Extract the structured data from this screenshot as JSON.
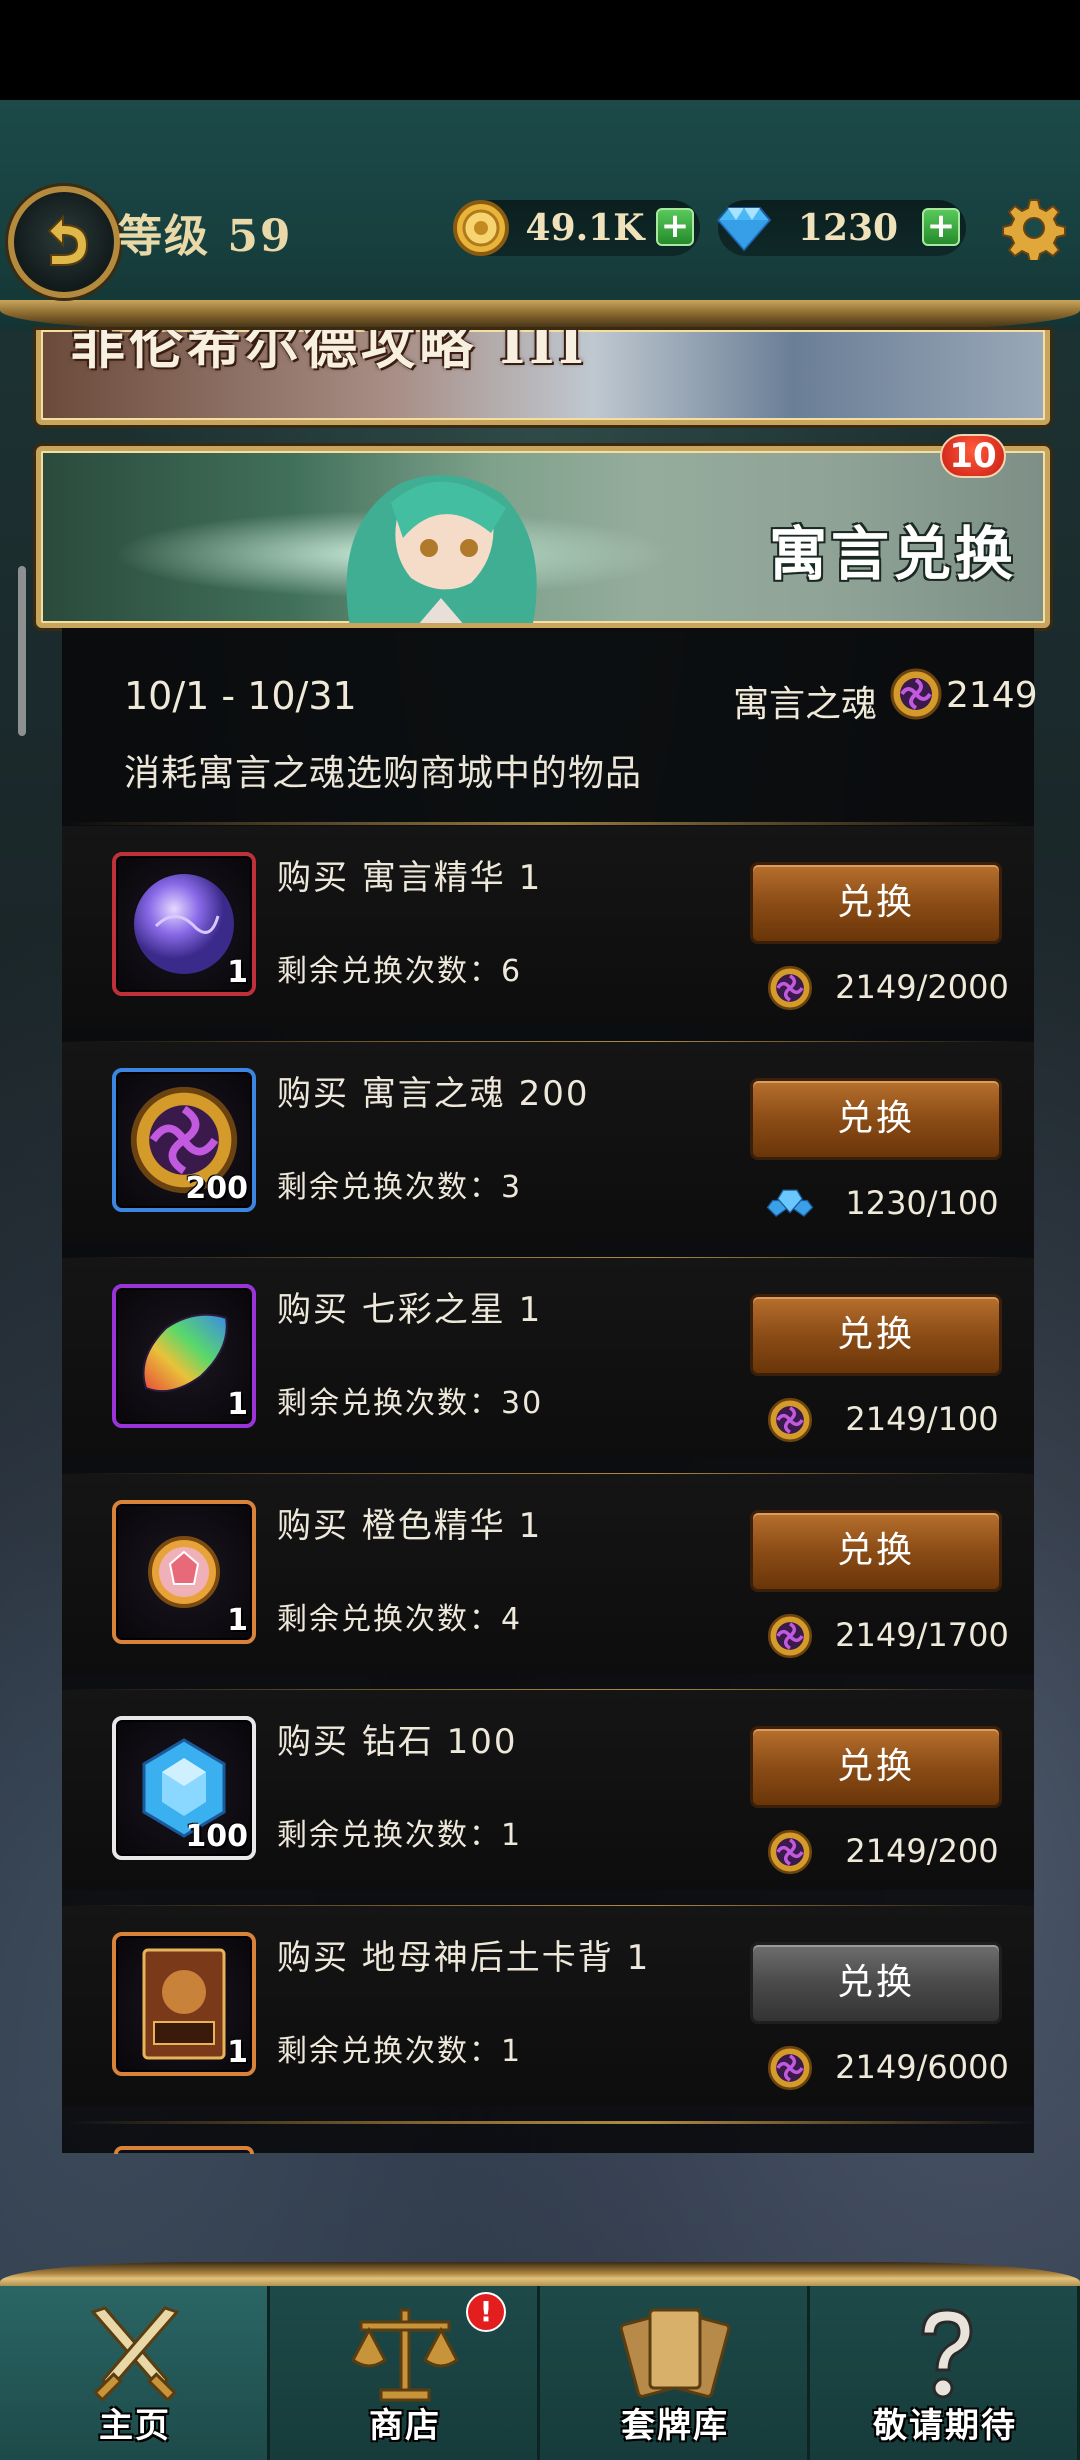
{
  "header": {
    "level_label": "等级 59",
    "coins": "49.1K",
    "gems": "1230",
    "plus_label": "+"
  },
  "banners": {
    "top_partial_title": "菲伦希尔德攻略 III",
    "exchange_title": "寓言兑换",
    "badge_count": "10"
  },
  "event": {
    "date_range": "10/1 - 10/31",
    "currency_label": "寓言之魂",
    "currency_amount": "2149",
    "description": "消耗寓言之魂选购商城中的物品"
  },
  "items": [
    {
      "title": "购买 寓言精华 1",
      "qty": "1",
      "remaining": "剩余兑换次数：6",
      "button": "兑换",
      "cost": "2149/2000",
      "cost_icon": "soul-icon",
      "frame_color": "red",
      "icon": "purple-orb-icon",
      "enabled": true
    },
    {
      "title": "购买 寓言之魂 200",
      "qty": "200",
      "remaining": "剩余兑换次数：3",
      "button": "兑换",
      "cost": "1230/100",
      "cost_icon": "diamond-pile-icon",
      "frame_color": "blue",
      "icon": "soul-icon",
      "enabled": true
    },
    {
      "title": "购买 七彩之星  1",
      "qty": "1",
      "remaining": "剩余兑换次数：30",
      "button": "兑换",
      "cost": "2149/100",
      "cost_icon": "soul-icon",
      "frame_color": "purple",
      "icon": "rainbow-star-icon",
      "enabled": true
    },
    {
      "title": "购买 橙色精华  1",
      "qty": "1",
      "remaining": "剩余兑换次数：4",
      "button": "兑换",
      "cost": "2149/1700",
      "cost_icon": "soul-icon",
      "frame_color": "orange",
      "icon": "orange-gem-icon",
      "enabled": true
    },
    {
      "title": "购买 钻石  100",
      "qty": "100",
      "remaining": "剩余兑换次数：1",
      "button": "兑换",
      "cost": "2149/200",
      "cost_icon": "soul-icon",
      "frame_color": "white",
      "icon": "diamond-icon",
      "enabled": true
    },
    {
      "title": "购买 地母神后土卡背 1",
      "qty": "1",
      "remaining": "剩余兑换次数：1",
      "button": "兑换",
      "cost": "2149/6000",
      "cost_icon": "soul-icon",
      "frame_color": "orange",
      "icon": "card-back-icon",
      "enabled": false
    }
  ],
  "nav": [
    {
      "label": "主页",
      "icon": "crossed-swords-icon",
      "active": true
    },
    {
      "label": "商店",
      "icon": "scales-icon",
      "active": false,
      "alert": "!"
    },
    {
      "label": "套牌库",
      "icon": "cards-icon",
      "active": false
    },
    {
      "label": "敬请期待",
      "icon": "question-icon",
      "active": false
    }
  ],
  "colors": {
    "accent_gold": "#c7a55e",
    "button_orange": "#8f4f18",
    "button_disabled": "#4a4a4a",
    "teal_bar": "#1c4a49"
  }
}
